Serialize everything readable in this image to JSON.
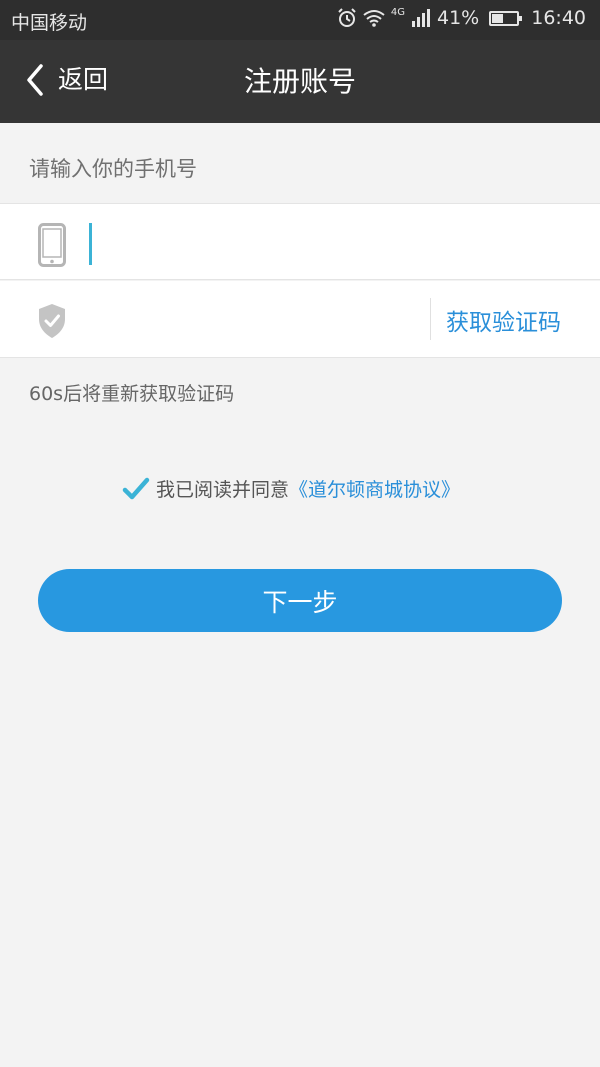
{
  "status_bar": {
    "carrier": "中国移动",
    "network": "4G",
    "battery_percent": "41%",
    "battery_level": 0.41,
    "time": "16:40",
    "icons": [
      "alarm-icon",
      "wifi-icon",
      "signal-icon",
      "battery-icon"
    ]
  },
  "nav": {
    "back_label": "返回",
    "title": "注册账号"
  },
  "form": {
    "hint": "请输入你的手机号",
    "phone_value": "",
    "code_value": "",
    "get_code_label": "获取验证码",
    "countdown_text": "60s后将重新获取验证码"
  },
  "agreement": {
    "checked": true,
    "text": "我已阅读并同意",
    "link": "《道尔顿商城协议》"
  },
  "actions": {
    "next_label": "下一步"
  },
  "colors": {
    "accent": "#2898e0",
    "link": "#2a8fd9",
    "check": "#3bb3d6",
    "nav_bg": "#353535",
    "page_bg": "#f3f3f3"
  }
}
